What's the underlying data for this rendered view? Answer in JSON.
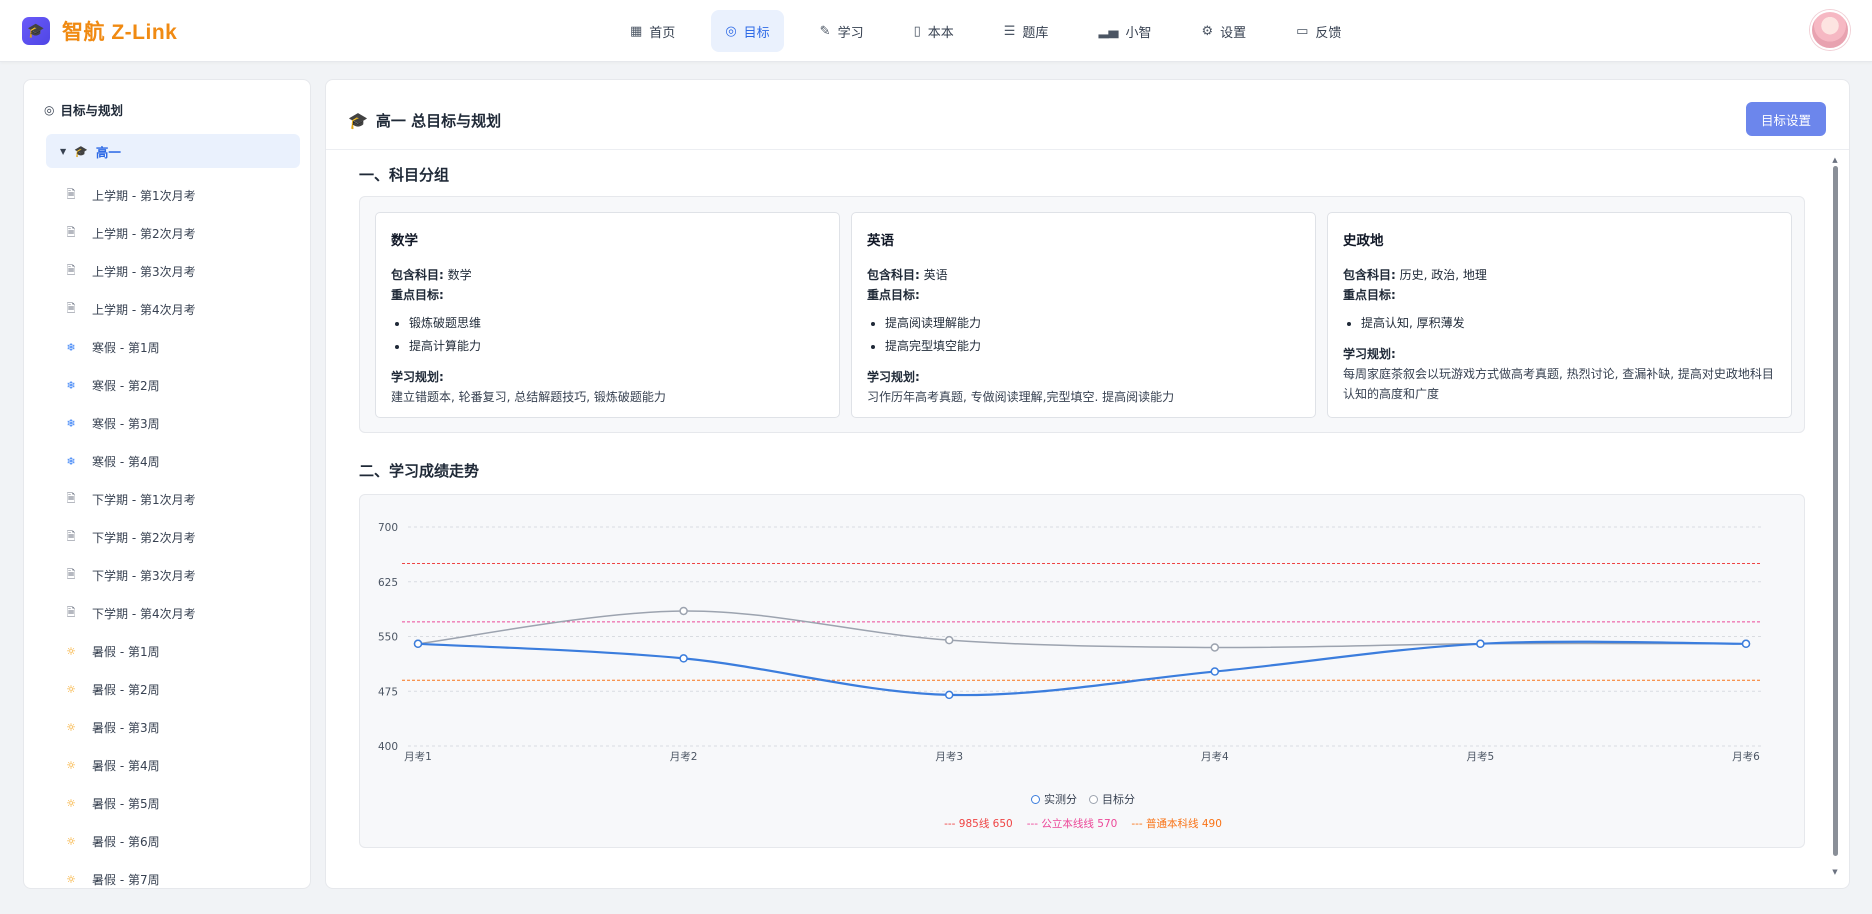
{
  "brand": {
    "name": "智航 Z-Link"
  },
  "nav": [
    {
      "label": "首页",
      "icon": "grid-icon",
      "glyph": "▦"
    },
    {
      "label": "目标",
      "icon": "target-icon",
      "glyph": "◎",
      "active": true
    },
    {
      "label": "学习",
      "icon": "edit-icon",
      "glyph": "✎"
    },
    {
      "label": "本本",
      "icon": "book-icon",
      "glyph": "▯"
    },
    {
      "label": "题库",
      "icon": "list-icon",
      "glyph": "☰"
    },
    {
      "label": "小智",
      "icon": "bar-chart-icon",
      "glyph": "▂▄"
    },
    {
      "label": "设置",
      "icon": "gear-icon",
      "glyph": "⚙"
    },
    {
      "label": "反馈",
      "icon": "message-icon",
      "glyph": "▭"
    }
  ],
  "sidebar": {
    "title": "目标与规划",
    "root": "高一",
    "items": [
      {
        "label": "上学期 - 第1次月考",
        "type": "doc"
      },
      {
        "label": "上学期 - 第2次月考",
        "type": "doc"
      },
      {
        "label": "上学期 - 第3次月考",
        "type": "doc"
      },
      {
        "label": "上学期 - 第4次月考",
        "type": "doc"
      },
      {
        "label": "寒假 - 第1周",
        "type": "snow"
      },
      {
        "label": "寒假 - 第2周",
        "type": "snow"
      },
      {
        "label": "寒假 - 第3周",
        "type": "snow"
      },
      {
        "label": "寒假 - 第4周",
        "type": "snow"
      },
      {
        "label": "下学期 - 第1次月考",
        "type": "doc"
      },
      {
        "label": "下学期 - 第2次月考",
        "type": "doc"
      },
      {
        "label": "下学期 - 第3次月考",
        "type": "doc"
      },
      {
        "label": "下学期 - 第4次月考",
        "type": "doc"
      },
      {
        "label": "暑假 - 第1周",
        "type": "sun"
      },
      {
        "label": "暑假 - 第2周",
        "type": "sun"
      },
      {
        "label": "暑假 - 第3周",
        "type": "sun"
      },
      {
        "label": "暑假 - 第4周",
        "type": "sun"
      },
      {
        "label": "暑假 - 第5周",
        "type": "sun"
      },
      {
        "label": "暑假 - 第6周",
        "type": "sun"
      },
      {
        "label": "暑假 - 第7周",
        "type": "sun"
      }
    ]
  },
  "main": {
    "title": "高一 总目标与规划",
    "goal_button": "目标设置",
    "section1": "一、科目分组",
    "section2": "二、学习成绩走势",
    "labels": {
      "subjects": "包含科目:",
      "focus": "重点目标:",
      "plan": "学习规划:"
    },
    "groups": [
      {
        "name": "数学",
        "subjects": "数学",
        "goals": [
          "锻炼破题思维",
          "提高计算能力"
        ],
        "plan": "建立错题本, 轮番复习, 总结解题技巧, 锻炼破题能力"
      },
      {
        "name": "英语",
        "subjects": "英语",
        "goals": [
          "提高阅读理解能力",
          "提高完型填空能力"
        ],
        "plan": "习作历年高考真题, 专做阅读理解,完型填空. 提高阅读能力"
      },
      {
        "name": "史政地",
        "subjects": "历史, 政治, 地理",
        "goals": [
          "提高认知, 厚积薄发"
        ],
        "plan": "每周家庭茶叙会以玩游戏方式做高考真题, 热烈讨论, 查漏补缺, 提高对史政地科目认知的高度和广度"
      }
    ]
  },
  "chart_data": {
    "type": "line",
    "x": [
      "月考1",
      "月考2",
      "月考3",
      "月考4",
      "月考5",
      "月考6"
    ],
    "ylim": [
      400,
      700
    ],
    "yticks": [
      "400",
      "475",
      "550",
      "625",
      "700"
    ],
    "grid": true,
    "series": [
      {
        "name": "实测分",
        "values": [
          540,
          520,
          470,
          502,
          540,
          540
        ],
        "color": "#3b7ddd"
      },
      {
        "name": "目标分",
        "values": [
          540,
          585,
          545,
          535,
          540,
          540
        ],
        "color": "#9ca3af"
      }
    ],
    "reference_lines": [
      {
        "label": "--- 985线 650",
        "value": 650,
        "color": "#ef4444"
      },
      {
        "label": "--- 公立本线线 570",
        "value": 570,
        "color": "#ec4899"
      },
      {
        "label": "--- 普通本科线 490",
        "value": 490,
        "color": "#f97316"
      }
    ],
    "legend_position": "bottom"
  }
}
